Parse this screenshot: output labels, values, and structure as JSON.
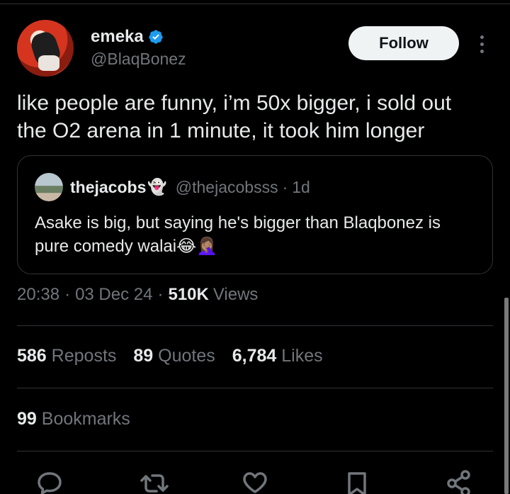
{
  "author": {
    "display_name": "emeka",
    "handle": "@BlaqBonez",
    "verified_icon": "verified-badge-icon",
    "verified_color": "#1d9bf0"
  },
  "header": {
    "follow_label": "Follow",
    "more_icon": "more-vertical-icon"
  },
  "tweet": {
    "text_line1": "like people are funny, i’m 50x bigger, i sold out",
    "text_line2": "the O2 arena in 1 minute, it took him longer"
  },
  "quote": {
    "display_name": "thejacobs",
    "name_emoji": "👻",
    "handle": "@thejacobsss",
    "separator": "·",
    "time": "1d",
    "text_line1": "Asake is big, but saying he's bigger than Blaqbonez is",
    "text_line2": "pure comedy walai😂🤦🏽‍♀️"
  },
  "meta": {
    "time": "20:38",
    "sep1": "·",
    "date": "03 Dec 24",
    "sep2": "·",
    "views_count": "510K",
    "views_label": "Views"
  },
  "stats": {
    "reposts_count": "586",
    "reposts_label": "Reposts",
    "quotes_count": "89",
    "quotes_label": "Quotes",
    "likes_count": "6,784",
    "likes_label": "Likes"
  },
  "bookmarks": {
    "count": "99",
    "label": "Bookmarks"
  },
  "actions": {
    "icons": [
      "reply-icon",
      "repost-icon",
      "like-icon",
      "bookmark-icon",
      "share-icon"
    ],
    "icon_color": "#71767b"
  }
}
